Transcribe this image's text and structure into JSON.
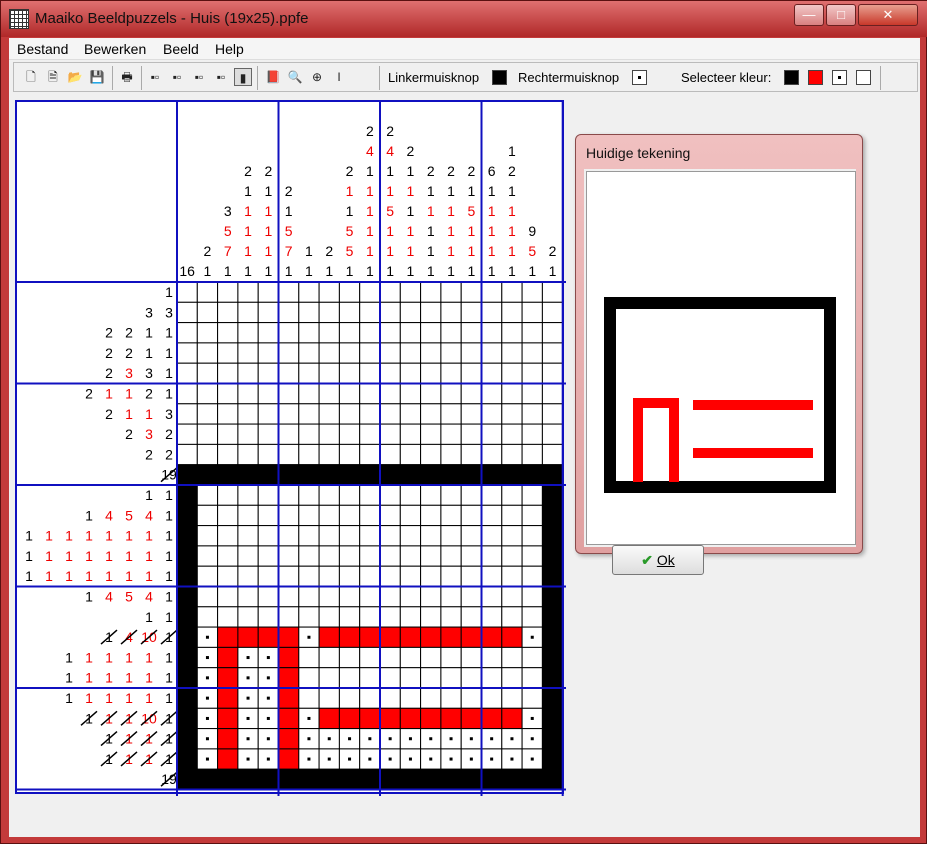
{
  "window": {
    "title": "Maaiko Beeldpuzzels - Huis (19x25).ppfe",
    "min": "—",
    "max": "□",
    "close": "✕"
  },
  "menu": [
    "Bestand",
    "Bewerken",
    "Beeld",
    "Help"
  ],
  "toolbar": {
    "left_label": "Linkermuisknop",
    "right_label": "Rechtermuisknop",
    "color_label": "Selecteer kleur:",
    "icons": [
      "new-icon",
      "new-template-icon",
      "open-icon",
      "save-icon",
      "print-icon",
      "layout-1-icon",
      "layout-2-icon",
      "layout-3-icon",
      "layout-4-icon",
      "layout-5-icon",
      "book-icon",
      "preview-icon",
      "zoom-icon",
      "text-cursor-icon"
    ],
    "colors": [
      "#000000",
      "#ff0000",
      "dot",
      "#ffffff"
    ]
  },
  "puzzle": {
    "cols": 19,
    "rows": 25,
    "col_clues": [
      [
        [
          16,
          "k"
        ]
      ],
      [
        [
          2,
          "k"
        ],
        [
          1,
          "k"
        ]
      ],
      [
        [
          3,
          "k"
        ],
        [
          5,
          "r"
        ],
        [
          7,
          "r"
        ],
        [
          1,
          "k"
        ]
      ],
      [
        [
          2,
          "k"
        ],
        [
          1,
          "k"
        ],
        [
          1,
          "r"
        ],
        [
          1,
          "r"
        ],
        [
          1,
          "r"
        ],
        [
          1,
          "k"
        ]
      ],
      [
        [
          2,
          "k"
        ],
        [
          1,
          "k"
        ],
        [
          1,
          "r"
        ],
        [
          1,
          "r"
        ],
        [
          1,
          "r"
        ],
        [
          1,
          "k"
        ]
      ],
      [
        [
          2,
          "k"
        ],
        [
          1,
          "k"
        ],
        [
          5,
          "r"
        ],
        [
          7,
          "r"
        ],
        [
          1,
          "k"
        ]
      ],
      [
        [
          1,
          "k"
        ],
        [
          1,
          "k"
        ]
      ],
      [
        [
          2,
          "k"
        ],
        [
          1,
          "k"
        ]
      ],
      [
        [
          2,
          "k"
        ],
        [
          1,
          "r"
        ],
        [
          1,
          "k"
        ],
        [
          5,
          "r"
        ],
        [
          5,
          "r"
        ],
        [
          1,
          "k"
        ]
      ],
      [
        [
          2,
          "k"
        ],
        [
          4,
          "r"
        ],
        [
          1,
          "k"
        ],
        [
          1,
          "r"
        ],
        [
          1,
          "r"
        ],
        [
          1,
          "r"
        ],
        [
          1,
          "r"
        ],
        [
          1,
          "k"
        ]
      ],
      [
        [
          2,
          "k"
        ],
        [
          4,
          "r"
        ],
        [
          1,
          "k"
        ],
        [
          1,
          "r"
        ],
        [
          5,
          "r"
        ],
        [
          1,
          "r"
        ],
        [
          1,
          "r"
        ],
        [
          1,
          "k"
        ]
      ],
      [
        [
          2,
          "k"
        ],
        [
          1,
          "k"
        ],
        [
          1,
          "r"
        ],
        [
          1,
          "k"
        ],
        [
          1,
          "r"
        ],
        [
          1,
          "r"
        ],
        [
          1,
          "k"
        ]
      ],
      [
        [
          2,
          "k"
        ],
        [
          1,
          "k"
        ],
        [
          1,
          "r"
        ],
        [
          1,
          "k"
        ],
        [
          1,
          "k"
        ],
        [
          1,
          "k"
        ]
      ],
      [
        [
          2,
          "k"
        ],
        [
          1,
          "k"
        ],
        [
          1,
          "r"
        ],
        [
          1,
          "r"
        ],
        [
          1,
          "r"
        ],
        [
          1,
          "k"
        ]
      ],
      [
        [
          2,
          "k"
        ],
        [
          1,
          "k"
        ],
        [
          5,
          "r"
        ],
        [
          1,
          "r"
        ],
        [
          1,
          "r"
        ],
        [
          1,
          "k"
        ]
      ],
      [
        [
          6,
          "k"
        ],
        [
          1,
          "k"
        ],
        [
          1,
          "r"
        ],
        [
          1,
          "r"
        ],
        [
          1,
          "r"
        ],
        [
          1,
          "k"
        ]
      ],
      [
        [
          1,
          "k"
        ],
        [
          2,
          "k"
        ],
        [
          1,
          "k"
        ],
        [
          1,
          "r"
        ],
        [
          1,
          "r"
        ],
        [
          1,
          "r"
        ],
        [
          1,
          "k"
        ]
      ],
      [
        [
          9,
          "k"
        ],
        [
          5,
          "r"
        ],
        [
          1,
          "k"
        ]
      ],
      [
        [
          2,
          "k"
        ],
        [
          1,
          "k"
        ]
      ],
      [
        [
          16,
          "k"
        ]
      ]
    ],
    "row_clues": [
      [
        [
          1,
          "k"
        ]
      ],
      [
        [
          3,
          "k"
        ],
        [
          3,
          "k"
        ]
      ],
      [
        [
          2,
          "k"
        ],
        [
          2,
          "k"
        ],
        [
          1,
          "k"
        ],
        [
          1,
          "k"
        ]
      ],
      [
        [
          2,
          "k"
        ],
        [
          2,
          "k"
        ],
        [
          1,
          "k"
        ],
        [
          1,
          "k"
        ]
      ],
      [
        [
          2,
          "k"
        ],
        [
          3,
          "r"
        ],
        [
          3,
          "k"
        ],
        [
          1,
          "k"
        ]
      ],
      [
        [
          2,
          "k"
        ],
        [
          1,
          "r"
        ],
        [
          1,
          "r"
        ],
        [
          2,
          "k"
        ],
        [
          1,
          "k"
        ]
      ],
      [
        [
          2,
          "k"
        ],
        [
          1,
          "r"
        ],
        [
          1,
          "r"
        ],
        [
          3,
          "k"
        ]
      ],
      [
        [
          2,
          "k"
        ],
        [
          3,
          "r"
        ],
        [
          2,
          "k"
        ]
      ],
      [
        [
          2,
          "k"
        ],
        [
          2,
          "k"
        ]
      ],
      [
        [
          19,
          "kx"
        ]
      ],
      [
        [
          1,
          "k"
        ],
        [
          1,
          "k"
        ]
      ],
      [
        [
          1,
          "k"
        ],
        [
          4,
          "r"
        ],
        [
          5,
          "r"
        ],
        [
          4,
          "r"
        ],
        [
          1,
          "k"
        ]
      ],
      [
        [
          1,
          "k"
        ],
        [
          1,
          "r"
        ],
        [
          1,
          "r"
        ],
        [
          1,
          "r"
        ],
        [
          1,
          "r"
        ],
        [
          1,
          "r"
        ],
        [
          1,
          "r"
        ],
        [
          1,
          "k"
        ]
      ],
      [
        [
          1,
          "k"
        ],
        [
          1,
          "r"
        ],
        [
          1,
          "r"
        ],
        [
          1,
          "r"
        ],
        [
          1,
          "r"
        ],
        [
          1,
          "r"
        ],
        [
          1,
          "r"
        ],
        [
          1,
          "k"
        ]
      ],
      [
        [
          1,
          "k"
        ],
        [
          1,
          "r"
        ],
        [
          1,
          "r"
        ],
        [
          1,
          "r"
        ],
        [
          1,
          "r"
        ],
        [
          1,
          "r"
        ],
        [
          1,
          "r"
        ],
        [
          1,
          "k"
        ]
      ],
      [
        [
          1,
          "k"
        ],
        [
          4,
          "r"
        ],
        [
          5,
          "r"
        ],
        [
          4,
          "r"
        ],
        [
          1,
          "k"
        ]
      ],
      [
        [
          1,
          "k"
        ],
        [
          1,
          "k"
        ]
      ],
      [
        [
          1,
          "kx"
        ],
        [
          4,
          "rx"
        ],
        [
          10,
          "rx"
        ],
        [
          1,
          "kx"
        ]
      ],
      [
        [
          1,
          "k"
        ],
        [
          1,
          "r"
        ],
        [
          1,
          "r"
        ],
        [
          1,
          "r"
        ],
        [
          1,
          "r"
        ],
        [
          1,
          "k"
        ]
      ],
      [
        [
          1,
          "k"
        ],
        [
          1,
          "r"
        ],
        [
          1,
          "r"
        ],
        [
          1,
          "r"
        ],
        [
          1,
          "r"
        ],
        [
          1,
          "k"
        ]
      ],
      [
        [
          1,
          "k"
        ],
        [
          1,
          "r"
        ],
        [
          1,
          "r"
        ],
        [
          1,
          "r"
        ],
        [
          1,
          "r"
        ],
        [
          1,
          "k"
        ]
      ],
      [
        [
          1,
          "kx"
        ],
        [
          1,
          "rx"
        ],
        [
          1,
          "rx"
        ],
        [
          10,
          "rx"
        ],
        [
          1,
          "kx"
        ]
      ],
      [
        [
          1,
          "kx"
        ],
        [
          1,
          "rx"
        ],
        [
          1,
          "rx"
        ],
        [
          1,
          "kx"
        ]
      ],
      [
        [
          1,
          "kx"
        ],
        [
          1,
          "rx"
        ],
        [
          1,
          "rx"
        ],
        [
          1,
          "kx"
        ]
      ],
      [
        [
          19,
          "kx"
        ]
      ]
    ]
  },
  "dialog": {
    "title": "Huidige tekening",
    "ok_label": "Ok",
    "ok_icon": "checkmark-icon"
  }
}
